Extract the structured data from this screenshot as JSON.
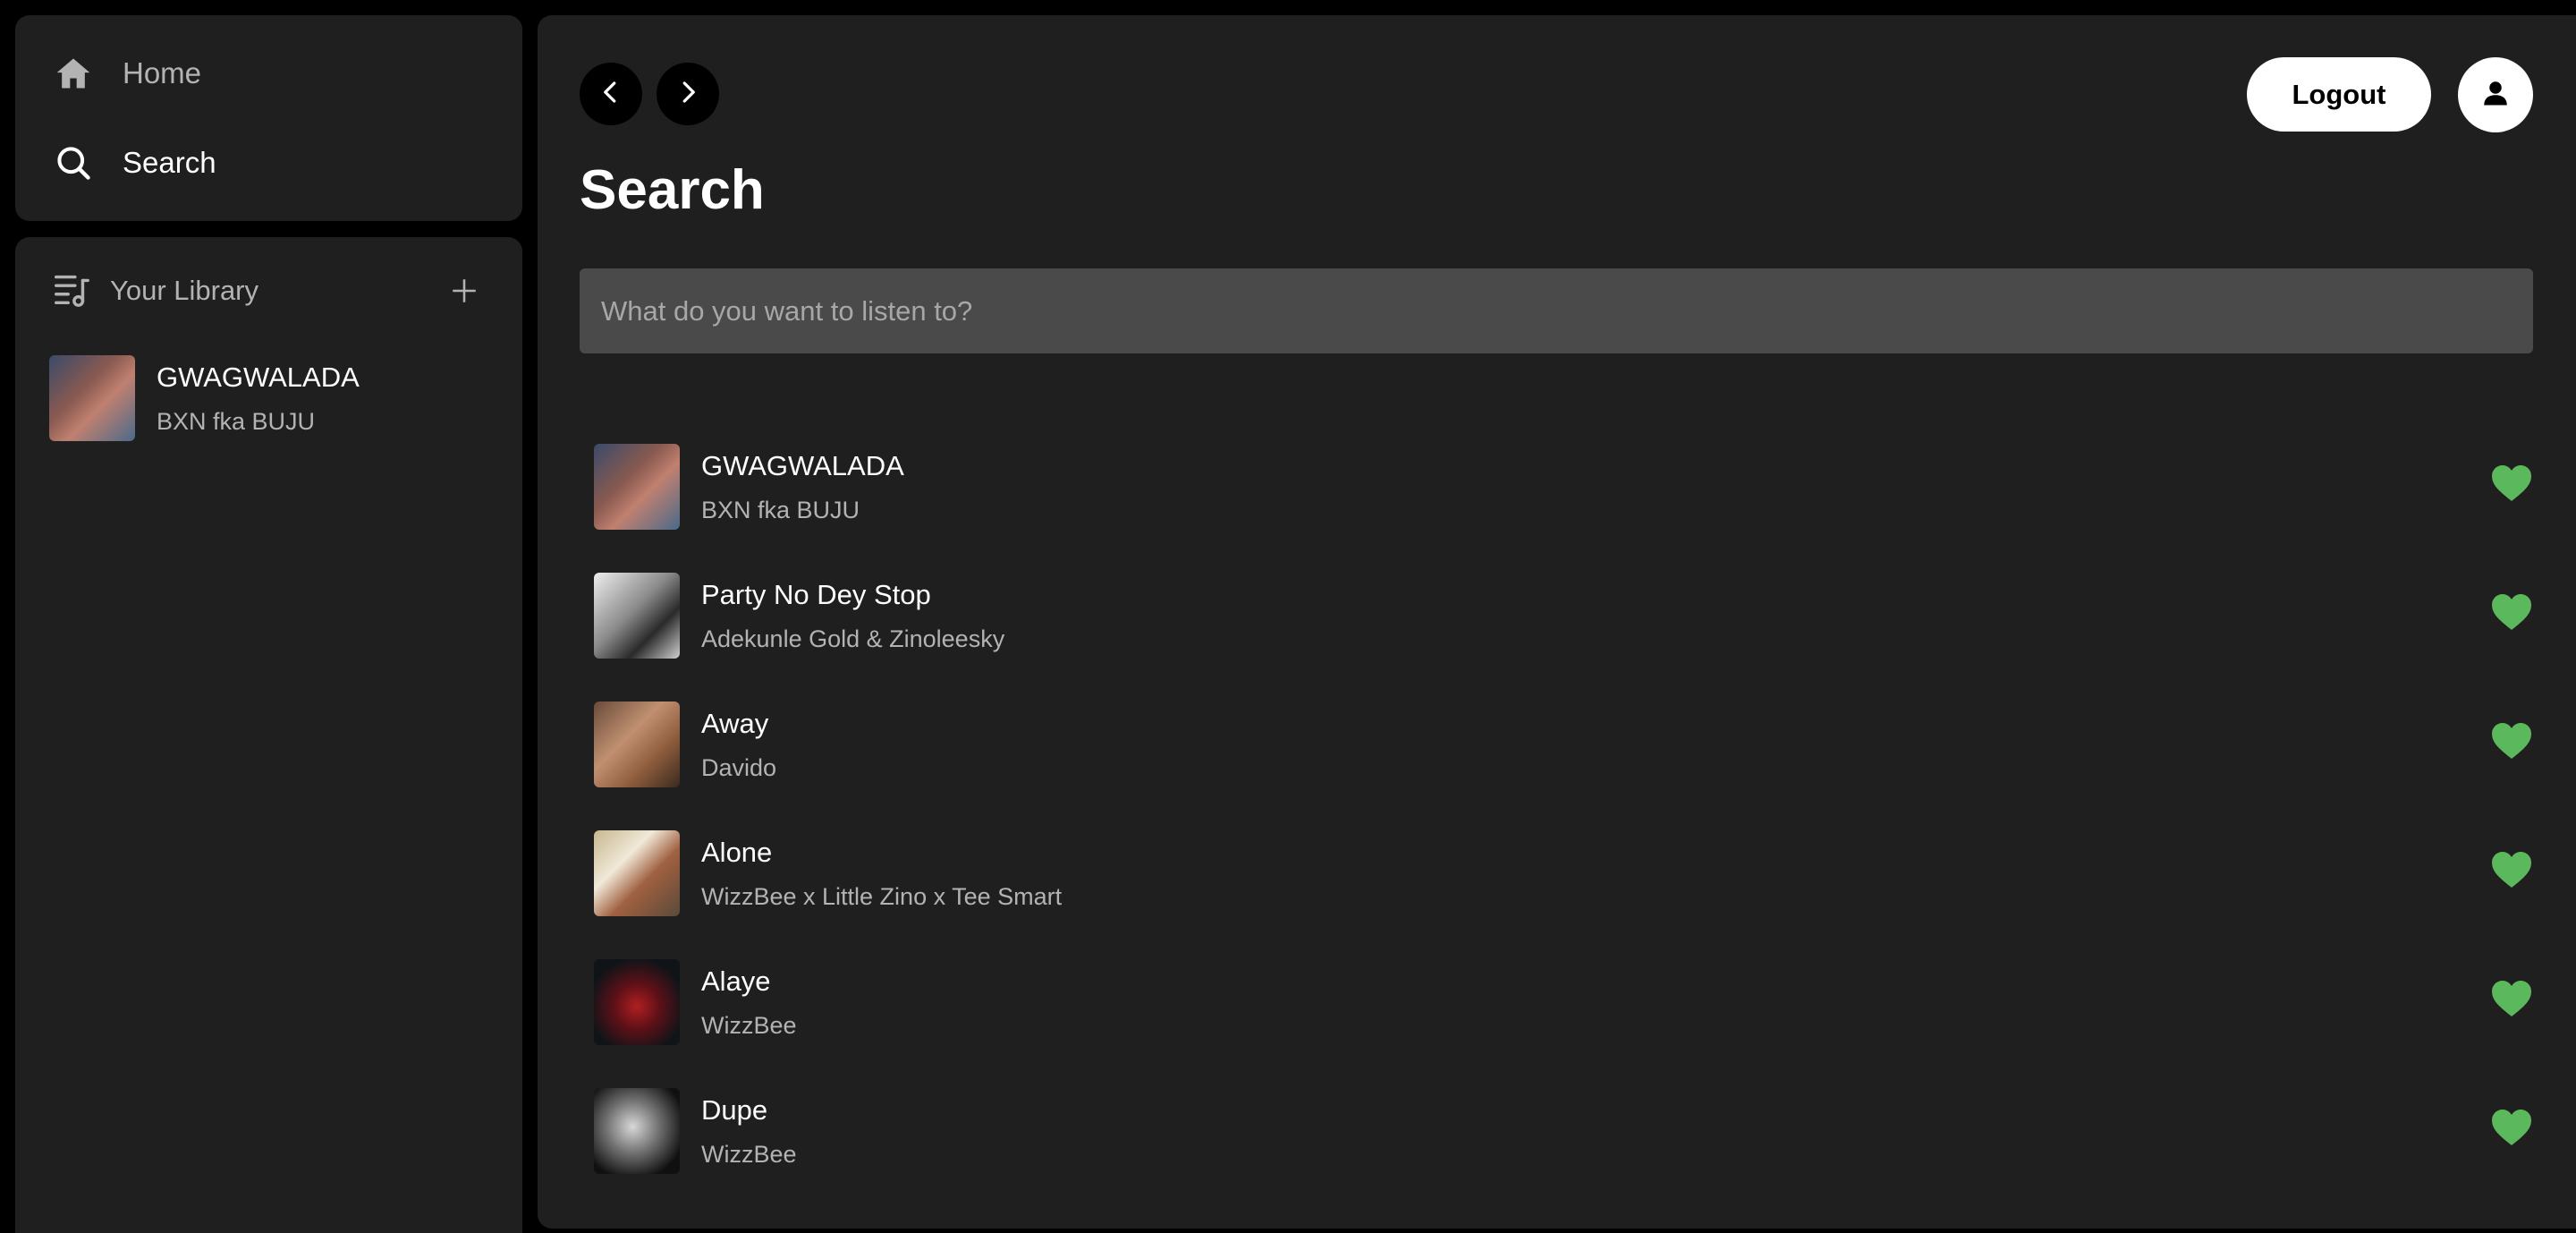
{
  "nav": {
    "home_label": "Home",
    "search_label": "Search"
  },
  "library": {
    "title": "Your Library",
    "items": [
      {
        "title": "GWAGWALADA",
        "artist": "BXN fka BUJU"
      }
    ]
  },
  "header": {
    "logout_label": "Logout"
  },
  "page": {
    "title": "Search",
    "search_placeholder": "What do you want to listen to?"
  },
  "tracks": [
    {
      "title": "GWAGWALADA",
      "artist": "BXN fka BUJU",
      "liked": true
    },
    {
      "title": "Party No Dey Stop",
      "artist": "Adekunle Gold & Zinoleesky",
      "liked": true
    },
    {
      "title": "Away",
      "artist": "Davido",
      "liked": true
    },
    {
      "title": "Alone",
      "artist": "WizzBee x Little Zino x Tee Smart",
      "liked": true
    },
    {
      "title": "Alaye",
      "artist": "WizzBee",
      "liked": true
    },
    {
      "title": "Dupe",
      "artist": "WizzBee",
      "liked": true
    }
  ],
  "colors": {
    "background": "#000000",
    "panel": "#1f1f1f",
    "search_field": "#4a4a4a",
    "liked_heart": "#5cb85c",
    "secondary_text": "#b3b3b3"
  },
  "icons": {
    "home": "home-icon",
    "search": "search-icon",
    "library": "library-icon",
    "add": "plus-icon",
    "back": "chevron-left-icon",
    "forward": "chevron-right-icon",
    "user": "user-icon",
    "like": "heart-icon"
  }
}
